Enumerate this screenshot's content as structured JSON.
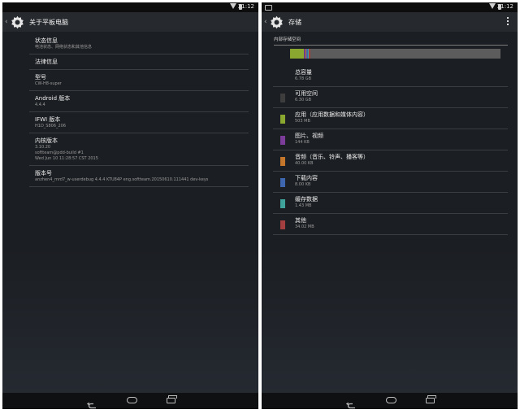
{
  "left": {
    "status_time": "21:12",
    "title": "关于平板电脑",
    "items": [
      {
        "title": "状态信息",
        "lines": [
          "电池状态、网络状态和其他信息"
        ]
      },
      {
        "title": "法律信息",
        "lines": []
      },
      {
        "title": "型号",
        "lines": [
          "CW-H8-super"
        ]
      },
      {
        "title": "Android 版本",
        "lines": [
          "4.4.4"
        ]
      },
      {
        "title": "IFWI 版本",
        "lines": [
          "H1D_S806_206"
        ]
      },
      {
        "title": "内核版本",
        "lines": [
          "3.10.20",
          "softteam@pdd-build #1",
          "Wed Jun 10 11:28:57 CST 2015"
        ]
      },
      {
        "title": "版本号",
        "lines": [
          "anzhen4_mrd7_w-userdebug 4.4.4 KTU84P eng.softteam.20150610.111441 dev-keys"
        ]
      }
    ]
  },
  "right": {
    "status_time": "21:12",
    "title": "存储",
    "section_header": "内部存储空间",
    "usage_segments": [
      {
        "color": "#8aa72f",
        "fraction": 0.065
      },
      {
        "color": "#6d3f8a",
        "fraction": 0.007
      },
      {
        "color": "#c4772a",
        "fraction": 0.006
      },
      {
        "color": "#3f67b0",
        "fraction": 0.006
      },
      {
        "color": "#3fa39b",
        "fraction": 0.005
      },
      {
        "color": "#a33f3f",
        "fraction": 0.008
      }
    ],
    "items": [
      {
        "title": "总容量",
        "value": "6.78 GB",
        "color": null
      },
      {
        "title": "可用空间",
        "value": "6.30 GB",
        "color": "#3d3d3d"
      },
      {
        "title": "应用（应用数据和媒体内容）",
        "value": "503 MB",
        "color": "#8aa72f"
      },
      {
        "title": "图片、视频",
        "value": "144 KB",
        "color": "#7b3d99"
      },
      {
        "title": "音频（音乐、铃声、播客等）",
        "value": "40.00 KB",
        "color": "#c4772a"
      },
      {
        "title": "下载内容",
        "value": "8.00 KB",
        "color": "#3f67b0"
      },
      {
        "title": "缓存数据",
        "value": "1.43 MB",
        "color": "#3fa39b"
      },
      {
        "title": "其他",
        "value": "34.02 MB",
        "color": "#a33f3f"
      }
    ]
  }
}
